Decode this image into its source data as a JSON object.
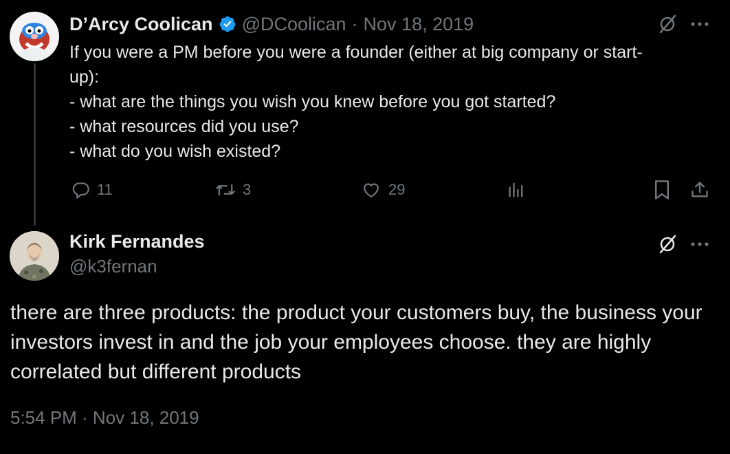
{
  "tweet1": {
    "author_name": "D’Arcy Coolican",
    "handle": "@DCoolican",
    "separator": "·",
    "date": "Nov 18, 2019",
    "verified": true,
    "lines": [
      "If you were a PM before you were a founder (either at big company or start-",
      "up):",
      "- what are the things you wish you knew before you got started?",
      "- what resources did you use?",
      "- what do you wish existed?"
    ],
    "replies": "11",
    "retweets": "3",
    "likes": "29"
  },
  "tweet2": {
    "author_name": "Kirk Fernandes",
    "handle": "@k3fernan",
    "text": "there are three products: the product your customers buy, the business your investors invest in and the job your employees choose. they are highly correlated but different products",
    "timestamp": "5:54 PM · Nov 18, 2019"
  },
  "colors": {
    "background": "#000000",
    "text": "#e7e9ea",
    "muted": "#71767b",
    "verified": "#1d9bf0"
  },
  "icons": {
    "grok": "grok-icon",
    "more": "more-icon",
    "reply": "reply-icon",
    "retweet": "retweet-icon",
    "like": "like-icon",
    "views": "views-icon",
    "bookmark": "bookmark-icon",
    "share": "share-icon"
  }
}
